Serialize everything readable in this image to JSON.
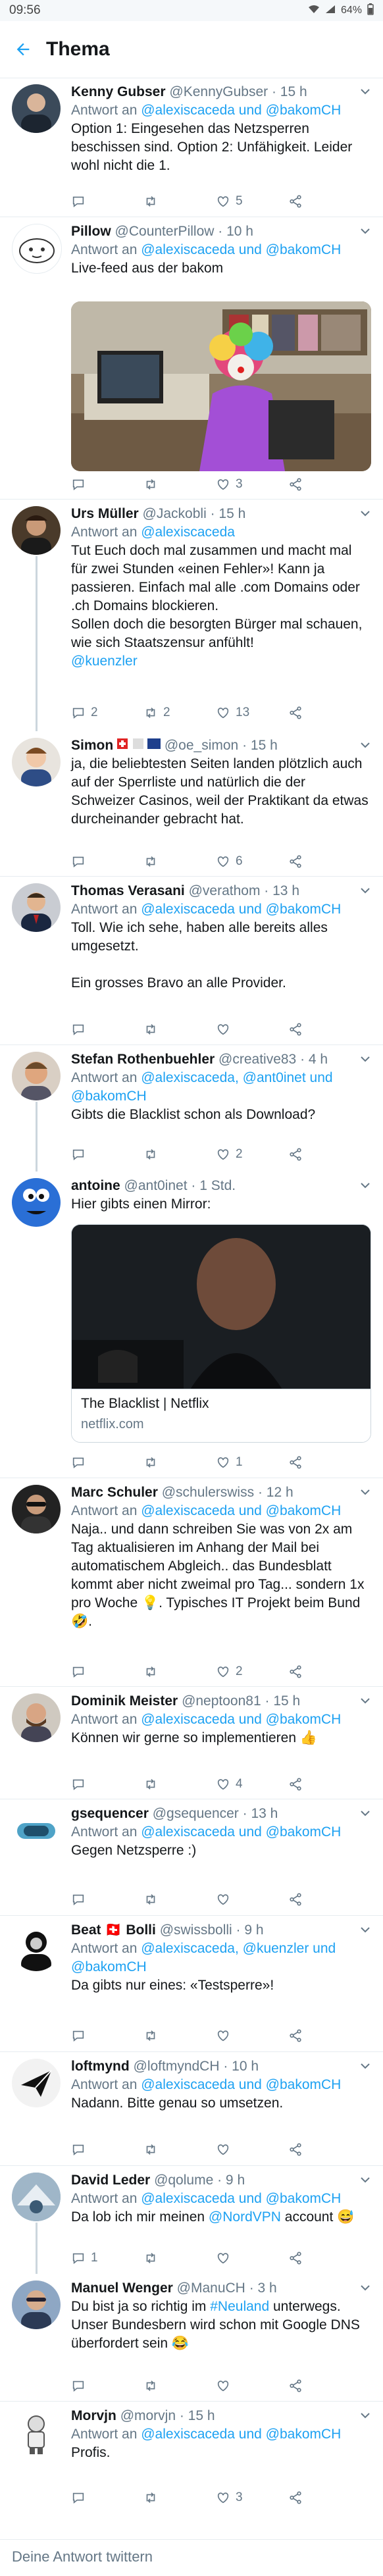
{
  "status_bar": {
    "time": "09:56",
    "battery": "64%"
  },
  "header": {
    "title": "Thema"
  },
  "tweets": [
    {
      "name": "Kenny Gubser",
      "handle": "@KennyGubser",
      "time": "· 15 h",
      "reply_prefix": "Antwort an",
      "reply_to": "@alexiscaceda und @bakomCH",
      "text": "Option 1: Eingesehen das Netzsperren beschissen sind. Option 2: Unfähigkeit. Leider wohl nicht die 1.",
      "replies": "",
      "retweets": "",
      "likes": "5"
    },
    {
      "name": "Pillow",
      "handle": "@CounterPillow",
      "time": "· 10 h",
      "reply_prefix": "Antwort an",
      "reply_to": "@alexiscaceda und @bakomCH",
      "text": "Live-feed aus der bakom",
      "replies": "",
      "retweets": "",
      "likes": "3"
    },
    {
      "name": "Urs Müller",
      "handle": "@Jackobli",
      "time": "· 15 h",
      "reply_prefix": "Antwort an",
      "reply_to": "@alexiscaceda",
      "text": "Tut Euch doch mal zusammen und macht mal für zwei Stunden «einen Fehler»! Kann ja passieren. Einfach mal alle .com Domains oder .ch Domains blockieren.\nSollen doch die besorgten Bürger mal schauen, wie sich Staatszensur anfühlt!",
      "mention_line": "@kuenzler",
      "replies": "2",
      "retweets": "2",
      "likes": "13"
    },
    {
      "name": "Simon",
      "handle": "@oe_simon",
      "time": "· 15 h",
      "text": "ja, die beliebtesten Seiten landen plötzlich auch auf der Sperrliste und natürlich die der Schweizer Casinos, weil der Praktikant da etwas durcheinander gebracht hat.",
      "replies": "",
      "retweets": "",
      "likes": "6"
    },
    {
      "name": "Thomas Verasani",
      "handle": "@verathom",
      "time": "· 13 h",
      "reply_prefix": "Antwort an",
      "reply_to": "@alexiscaceda und @bakomCH",
      "text": "Toll. Wie ich sehe, haben alle bereits alles umgesetzt.\n\nEin grosses Bravo an alle Provider.",
      "replies": "",
      "retweets": "",
      "likes": ""
    },
    {
      "name": "Stefan Rothenbuehler",
      "handle": "@creative83",
      "time": "· 4 h",
      "reply_prefix": "Antwort an",
      "reply_to": "@alexiscaceda, @ant0inet und @bakomCH",
      "text": "Gibts die Blacklist schon als Download?",
      "replies": "",
      "retweets": "",
      "likes": "2"
    },
    {
      "name": "antoine",
      "handle": "@ant0inet",
      "time": "· 1 Std.",
      "text": "Hier gibts einen Mirror:",
      "card_title": "The Blacklist | Netflix",
      "card_domain": "netflix.com",
      "replies": "",
      "retweets": "",
      "likes": "1"
    },
    {
      "name": "Marc Schuler",
      "handle": "@schulerswiss",
      "time": "· 12 h",
      "reply_prefix": "Antwort an",
      "reply_to": "@alexiscaceda und @bakomCH",
      "text": "Naja.. und dann schreiben Sie was von 2x am Tag aktualisieren im Anhang der Mail bei automatischem Abgleich.. das Bundesblatt kommt aber nicht zweimal pro Tag... sondern 1x pro Woche 💡. Typisches IT Projekt beim Bund 🤣.",
      "replies": "",
      "retweets": "",
      "likes": "2"
    },
    {
      "name": "Dominik Meister",
      "handle": "@neptoon81",
      "time": "· 15 h",
      "reply_prefix": "Antwort an",
      "reply_to": "@alexiscaceda und @bakomCH",
      "text": "Können wir gerne so implementieren 👍",
      "replies": "",
      "retweets": "",
      "likes": "4"
    },
    {
      "name": "gsequencer",
      "handle": "@gsequencer",
      "time": "· 13 h",
      "reply_prefix": "Antwort an",
      "reply_to": "@alexiscaceda und @bakomCH",
      "text": "Gegen Netzsperre :)",
      "replies": "",
      "retweets": "",
      "likes": ""
    },
    {
      "name": "Beat 🇨🇭 Bolli",
      "handle": "@swissbolli",
      "time": "· 9 h",
      "reply_prefix": "Antwort an",
      "reply_to": "@alexiscaceda, @kuenzler und @bakomCH",
      "text": "Da gibts nur eines: «Testsperre»!",
      "replies": "",
      "retweets": "",
      "likes": ""
    },
    {
      "name": "loftmynd",
      "handle": "@loftmyndCH",
      "time": "· 10 h",
      "reply_prefix": "Antwort an",
      "reply_to": "@alexiscaceda und @bakomCH",
      "text": "Nadann. Bitte genau so umsetzen.",
      "replies": "",
      "retweets": "",
      "likes": ""
    },
    {
      "name": "David Leder",
      "handle": "@qolume",
      "time": "· 9 h",
      "reply_prefix": "Antwort an",
      "reply_to": "@alexiscaceda und @bakomCH",
      "text_before": "Da lob ich mir meinen ",
      "text_mention": "@NordVPN",
      "text_after": " account 😅",
      "replies": "1",
      "retweets": "",
      "likes": ""
    },
    {
      "name": "Manuel Wenger",
      "handle": "@ManuCH",
      "time": "· 3 h",
      "text_before": "Du bist ja so richtig im ",
      "text_mention": "#Neuland",
      "text_after": " unterwegs. Unser Bundesbern wird schon mit Google DNS überfordert sein 😂",
      "replies": "",
      "retweets": "",
      "likes": ""
    },
    {
      "name": "Morvjn",
      "handle": "@morvjn",
      "time": "· 15 h",
      "reply_prefix": "Antwort an",
      "reply_to": "@alexiscaceda und @bakomCH",
      "text": "Profis.",
      "replies": "",
      "retweets": "",
      "likes": "3"
    }
  ],
  "reply_bar": {
    "placeholder": "Deine Antwort twittern"
  },
  "colors": {
    "accent": "#1da1f2",
    "muted": "#657786",
    "text": "#14171a",
    "divider": "#e6ecf0"
  },
  "icons": [
    "back-arrow-icon",
    "chevron-down-icon",
    "reply-icon",
    "retweet-icon",
    "like-icon",
    "share-icon"
  ]
}
